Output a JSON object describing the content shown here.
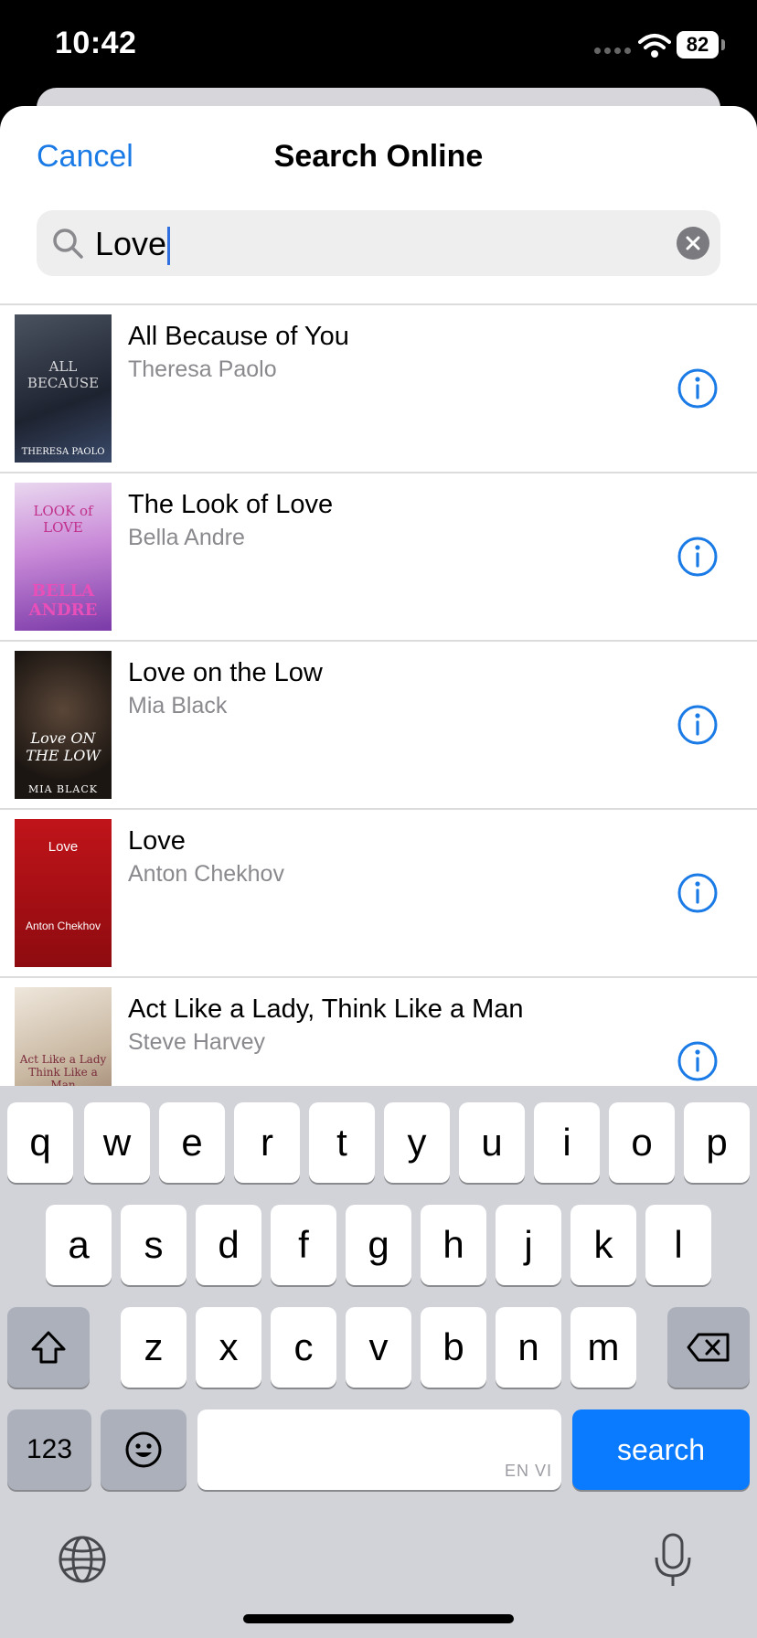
{
  "status": {
    "time": "10:42",
    "battery": "82"
  },
  "nav": {
    "cancel_label": "Cancel",
    "title": "Search Online"
  },
  "search": {
    "value": "Love"
  },
  "results": [
    {
      "title": "All Because of You",
      "author": "Theresa Paolo",
      "cover_text_top": "ALL BECAUSE",
      "cover_text_bottom": "THERESA PAOLO",
      "cover_color": "#2a2f3a"
    },
    {
      "title": "The Look of Love",
      "author": "Bella Andre",
      "cover_text_top": "LOOK of LOVE",
      "cover_text_bottom": "BELLA ANDRE",
      "cover_color": "#8f4fb8"
    },
    {
      "title": "Love on the Low",
      "author": "Mia Black",
      "cover_text_top": "Love ON THE LOW",
      "cover_text_bottom": "MIA BLACK",
      "cover_color": "#1c1612"
    },
    {
      "title": "Love",
      "author": "Anton Chekhov",
      "cover_text_top": "Love",
      "cover_text_bottom": "Anton Chekhov",
      "cover_color": "#a30f12"
    },
    {
      "title": "Act Like a Lady, Think Like a Man",
      "author": "Steve Harvey",
      "cover_text_top": "Act Like a Lady Think Like a Man",
      "cover_text_bottom": "",
      "cover_color": "#d8cfc2"
    }
  ],
  "keyboard": {
    "row1": [
      "q",
      "w",
      "e",
      "r",
      "t",
      "y",
      "u",
      "i",
      "o",
      "p"
    ],
    "row2": [
      "a",
      "s",
      "d",
      "f",
      "g",
      "h",
      "j",
      "k",
      "l"
    ],
    "row3": [
      "z",
      "x",
      "c",
      "v",
      "b",
      "n",
      "m"
    ],
    "numbers_label": "123",
    "space_hint": "EN VI",
    "search_label": "search"
  },
  "colors": {
    "accent": "#1a7ae6",
    "search_key": "#0a7bff"
  }
}
